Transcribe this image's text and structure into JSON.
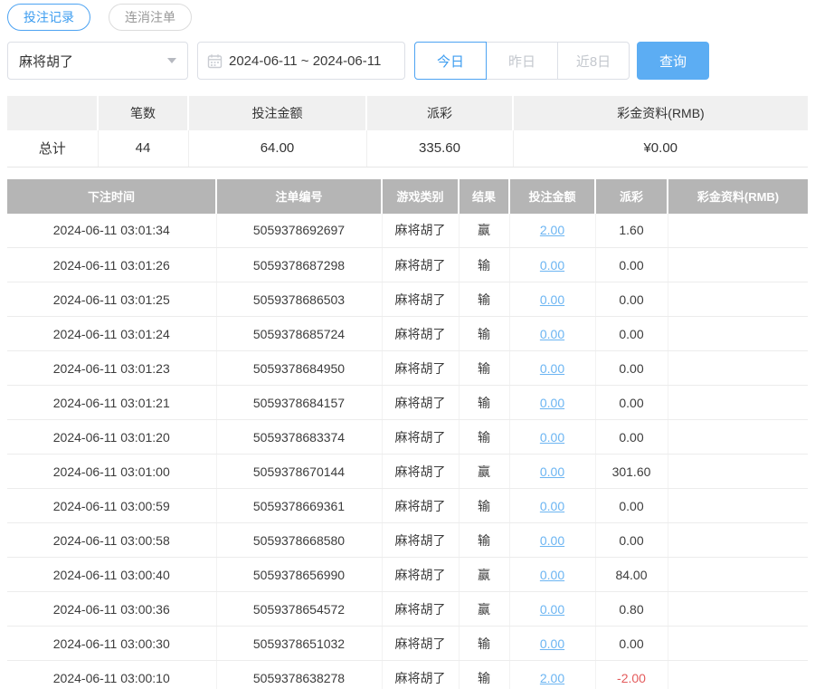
{
  "tabs": [
    {
      "label": "投注记录",
      "active": true
    },
    {
      "label": "连消注单",
      "active": false
    }
  ],
  "filters": {
    "game_select": {
      "value": "麻将胡了"
    },
    "date_range": "2024-06-11 ~ 2024-06-11",
    "quick_buttons": [
      {
        "label": "今日",
        "active": true
      },
      {
        "label": "昨日",
        "active": false
      },
      {
        "label": "近8日",
        "active": false
      }
    ],
    "search_label": "查询"
  },
  "summary": {
    "headers": [
      "",
      "笔数",
      "投注金额",
      "派彩",
      "彩金资料(RMB)"
    ],
    "row": {
      "label": "总计",
      "count": "44",
      "bet_amount": "64.00",
      "payout": "335.60",
      "bonus": "¥0.00"
    }
  },
  "table": {
    "headers": [
      "下注时间",
      "注单编号",
      "游戏类别",
      "结果",
      "投注金额",
      "派彩",
      "彩金资料(RMB)"
    ],
    "rows": [
      {
        "time": "2024-06-11 03:01:34",
        "order_no": "5059378692697",
        "game": "麻将胡了",
        "result": "赢",
        "bet": "2.00",
        "payout": "1.60",
        "bonus": ""
      },
      {
        "time": "2024-06-11 03:01:26",
        "order_no": "5059378687298",
        "game": "麻将胡了",
        "result": "输",
        "bet": "0.00",
        "payout": "0.00",
        "bonus": ""
      },
      {
        "time": "2024-06-11 03:01:25",
        "order_no": "5059378686503",
        "game": "麻将胡了",
        "result": "输",
        "bet": "0.00",
        "payout": "0.00",
        "bonus": ""
      },
      {
        "time": "2024-06-11 03:01:24",
        "order_no": "5059378685724",
        "game": "麻将胡了",
        "result": "输",
        "bet": "0.00",
        "payout": "0.00",
        "bonus": ""
      },
      {
        "time": "2024-06-11 03:01:23",
        "order_no": "5059378684950",
        "game": "麻将胡了",
        "result": "输",
        "bet": "0.00",
        "payout": "0.00",
        "bonus": ""
      },
      {
        "time": "2024-06-11 03:01:21",
        "order_no": "5059378684157",
        "game": "麻将胡了",
        "result": "输",
        "bet": "0.00",
        "payout": "0.00",
        "bonus": ""
      },
      {
        "time": "2024-06-11 03:01:20",
        "order_no": "5059378683374",
        "game": "麻将胡了",
        "result": "输",
        "bet": "0.00",
        "payout": "0.00",
        "bonus": ""
      },
      {
        "time": "2024-06-11 03:01:00",
        "order_no": "5059378670144",
        "game": "麻将胡了",
        "result": "赢",
        "bet": "0.00",
        "payout": "301.60",
        "bonus": ""
      },
      {
        "time": "2024-06-11 03:00:59",
        "order_no": "5059378669361",
        "game": "麻将胡了",
        "result": "输",
        "bet": "0.00",
        "payout": "0.00",
        "bonus": ""
      },
      {
        "time": "2024-06-11 03:00:58",
        "order_no": "5059378668580",
        "game": "麻将胡了",
        "result": "输",
        "bet": "0.00",
        "payout": "0.00",
        "bonus": ""
      },
      {
        "time": "2024-06-11 03:00:40",
        "order_no": "5059378656990",
        "game": "麻将胡了",
        "result": "赢",
        "bet": "0.00",
        "payout": "84.00",
        "bonus": ""
      },
      {
        "time": "2024-06-11 03:00:36",
        "order_no": "5059378654572",
        "game": "麻将胡了",
        "result": "赢",
        "bet": "0.00",
        "payout": "0.80",
        "bonus": ""
      },
      {
        "time": "2024-06-11 03:00:30",
        "order_no": "5059378651032",
        "game": "麻将胡了",
        "result": "输",
        "bet": "0.00",
        "payout": "0.00",
        "bonus": ""
      },
      {
        "time": "2024-06-11 03:00:10",
        "order_no": "5059378638278",
        "game": "麻将胡了",
        "result": "输",
        "bet": "2.00",
        "payout": "-2.00",
        "bonus": ""
      }
    ]
  },
  "colors": {
    "accent_blue": "#3d9df0",
    "button_fill_blue": "#5cadf3",
    "table_header_gray": "#b5b5b5",
    "link_blue": "#6cb5f2",
    "negative_red": "#e45b5c",
    "summary_header_bg": "#f0f0f0"
  },
  "icons": {
    "calendar": "calendar-icon",
    "select_caret": "chevron-down-icon"
  }
}
